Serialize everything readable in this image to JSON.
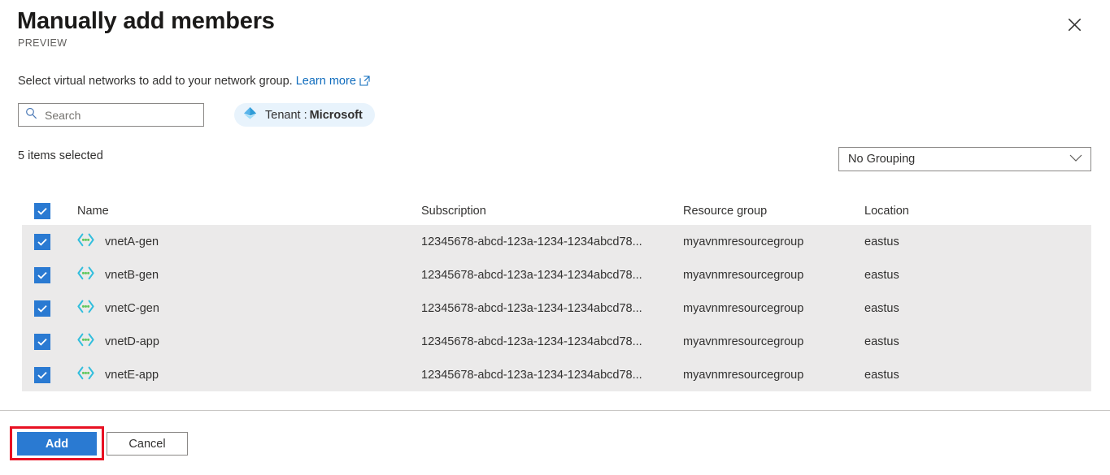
{
  "header": {
    "title": "Manually add members",
    "preview_tag": "PREVIEW",
    "close_icon": "close-icon"
  },
  "description": {
    "text": "Select virtual networks to add to your network group.",
    "link_label": "Learn more",
    "link_icon": "external-link-icon"
  },
  "search": {
    "placeholder": "Search",
    "value": "",
    "icon": "search-icon"
  },
  "tenant_filter": {
    "icon": "azure-tenant-icon",
    "label": "Tenant :",
    "value": "Microsoft"
  },
  "toolbar": {
    "items_selected": "5 items selected",
    "grouping_value": "No Grouping",
    "grouping_icon": "chevron-down-icon"
  },
  "table": {
    "select_all_checked": true,
    "columns": {
      "name": "Name",
      "subscription": "Subscription",
      "resource_group": "Resource group",
      "location": "Location"
    },
    "rows": [
      {
        "checked": true,
        "icon": "virtual-network-icon",
        "name": "vnetA-gen",
        "subscription": "12345678-abcd-123a-1234-1234abcd78...",
        "resource_group": "myavnmresourcegroup",
        "location": "eastus"
      },
      {
        "checked": true,
        "icon": "virtual-network-icon",
        "name": "vnetB-gen",
        "subscription": "12345678-abcd-123a-1234-1234abcd78...",
        "resource_group": "myavnmresourcegroup",
        "location": "eastus"
      },
      {
        "checked": true,
        "icon": "virtual-network-icon",
        "name": "vnetC-gen",
        "subscription": "12345678-abcd-123a-1234-1234abcd78...",
        "resource_group": "myavnmresourcegroup",
        "location": "eastus"
      },
      {
        "checked": true,
        "icon": "virtual-network-icon",
        "name": "vnetD-app",
        "subscription": "12345678-abcd-123a-1234-1234abcd78...",
        "resource_group": "myavnmresourcegroup",
        "location": "eastus"
      },
      {
        "checked": true,
        "icon": "virtual-network-icon",
        "name": "vnetE-app",
        "subscription": "12345678-abcd-123a-1234-1234abcd78...",
        "resource_group": "myavnmresourcegroup",
        "location": "eastus"
      }
    ]
  },
  "footer": {
    "add_label": "Add",
    "cancel_label": "Cancel"
  },
  "colors": {
    "accent_blue": "#2a7ad2",
    "link_blue": "#0f6cbd",
    "row_selected_gray": "#ebeaea",
    "tenant_pill_bg": "#e8f3fc",
    "highlight_red": "#e81123"
  }
}
